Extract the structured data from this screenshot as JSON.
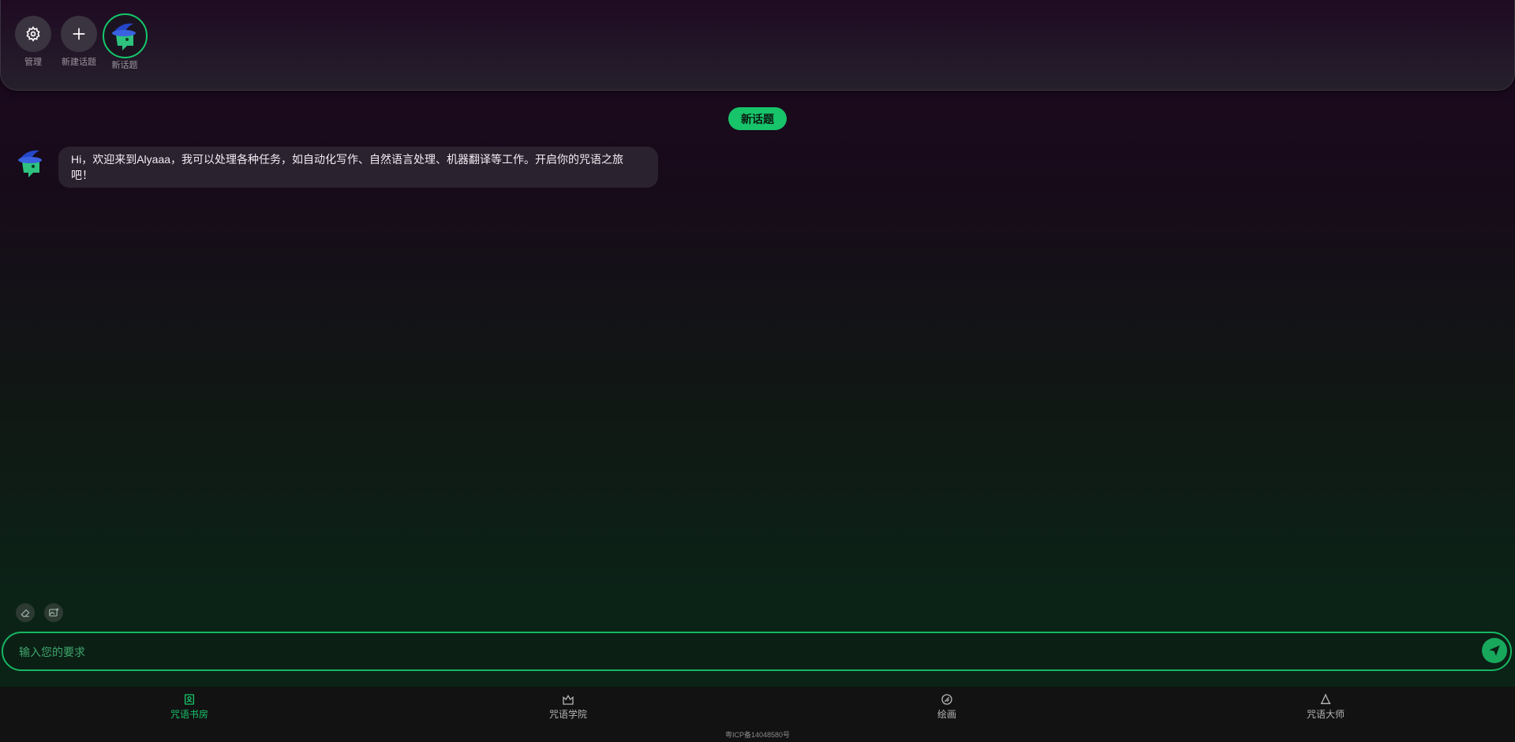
{
  "topbar": {
    "items": [
      {
        "label": "管理",
        "icon": "gear-icon"
      },
      {
        "label": "新建话题",
        "icon": "plus-icon"
      },
      {
        "label": "新话题",
        "icon": "wizard-avatar"
      }
    ]
  },
  "chat": {
    "title": "新话题",
    "messages": [
      {
        "role": "assistant",
        "text": "Hi，欢迎来到Alyaaa，我可以处理各种任务，如自动化写作、自然语言处理、机器翻译等工作。开启你的咒语之旅吧！"
      }
    ]
  },
  "tools": [
    {
      "icon": "eraser-icon"
    },
    {
      "icon": "image-add-icon"
    }
  ],
  "input": {
    "placeholder": "输入您的要求",
    "value": ""
  },
  "nav": {
    "items": [
      {
        "label": "咒语书房",
        "icon": "book-icon",
        "active": true
      },
      {
        "label": "咒语学院",
        "icon": "academy-icon",
        "active": false
      },
      {
        "label": "绘画",
        "icon": "palette-icon",
        "active": false
      },
      {
        "label": "咒语大师",
        "icon": "wizard-hat-icon",
        "active": false
      }
    ]
  },
  "footer": {
    "icp": "粤ICP备14048580号"
  },
  "colors": {
    "accent": "#18c46a",
    "bubble": "#2b2230"
  }
}
